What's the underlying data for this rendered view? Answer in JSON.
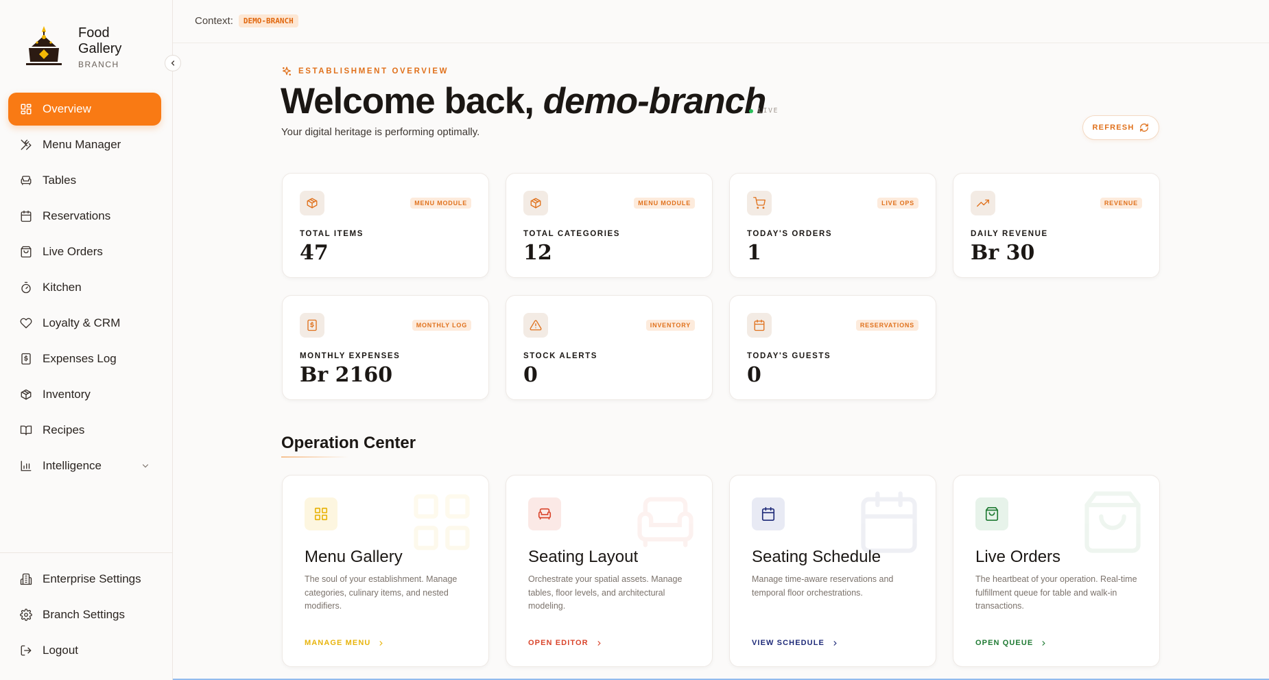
{
  "brand": {
    "name_line1": "Food",
    "name_line2": "Gallery",
    "sub": "BRANCH"
  },
  "sidebar": {
    "items": [
      {
        "label": "Overview",
        "icon": "grid-icon",
        "active": true
      },
      {
        "label": "Menu Manager",
        "icon": "utensils-icon"
      },
      {
        "label": "Tables",
        "icon": "armchair-icon"
      },
      {
        "label": "Reservations",
        "icon": "calendar-icon"
      },
      {
        "label": "Live Orders",
        "icon": "shopping-bag-icon"
      },
      {
        "label": "Kitchen",
        "icon": "timer-icon"
      },
      {
        "label": "Loyalty & CRM",
        "icon": "heart-icon"
      },
      {
        "label": "Expenses Log",
        "icon": "receipt-icon"
      },
      {
        "label": "Inventory",
        "icon": "package-icon"
      },
      {
        "label": "Recipes",
        "icon": "book-open-icon"
      },
      {
        "label": "Intelligence",
        "icon": "bar-chart-icon"
      }
    ],
    "bottom": [
      {
        "label": "Enterprise Settings",
        "icon": "building-icon"
      },
      {
        "label": "Branch Settings",
        "icon": "gear-icon"
      },
      {
        "label": "Logout",
        "icon": "logout-icon"
      }
    ]
  },
  "topbar": {
    "context_label": "Context:",
    "context_value": "DEMO-BRANCH"
  },
  "header": {
    "eyebrow": "ESTABLISHMENT OVERVIEW",
    "welcome_prefix": "Welcome back,",
    "welcome_name": "demo-branch",
    "live_label": "LIVE",
    "subtitle": "Your digital heritage is performing optimally.",
    "refresh_label": "REFRESH"
  },
  "stats": [
    {
      "label": "TOTAL ITEMS",
      "value": "47",
      "tag": "MENU MODULE",
      "icon": "package-icon"
    },
    {
      "label": "TOTAL CATEGORIES",
      "value": "12",
      "tag": "MENU MODULE",
      "icon": "package-icon"
    },
    {
      "label": "TODAY'S ORDERS",
      "value": "1",
      "tag": "LIVE OPS",
      "icon": "cart-icon"
    },
    {
      "label": "DAILY REVENUE",
      "value": "Br 30",
      "tag": "REVENUE",
      "icon": "trending-up-icon"
    },
    {
      "label": "MONTHLY EXPENSES",
      "value": "Br 2160",
      "tag": "MONTHLY LOG",
      "icon": "receipt-icon"
    },
    {
      "label": "STOCK ALERTS",
      "value": "0",
      "tag": "INVENTORY",
      "icon": "alert-triangle-icon"
    },
    {
      "label": "TODAY'S GUESTS",
      "value": "0",
      "tag": "RESERVATIONS",
      "icon": "calendar-icon"
    }
  ],
  "operation": {
    "title": "Operation Center",
    "cards": [
      {
        "title": "Menu Gallery",
        "desc": "The soul of your establishment. Manage categories, culinary items, and nested modifiers.",
        "link": "MANAGE MENU",
        "accent": "#e8b40c",
        "bg": "#fdf6e0",
        "icon": "grid-icon"
      },
      {
        "title": "Seating Layout",
        "desc": "Orchestrate your spatial assets. Manage tables, floor levels, and architectural modeling.",
        "link": "OPEN EDITOR",
        "accent": "#d9442b",
        "bg": "#fbe9e6",
        "icon": "armchair-icon"
      },
      {
        "title": "Seating Schedule",
        "desc": "Manage time-aware reservations and temporal floor orchestrations.",
        "link": "VIEW SCHEDULE",
        "accent": "#1e2a78",
        "bg": "#e8eaf4",
        "icon": "calendar-icon"
      },
      {
        "title": "Live Orders",
        "desc": "The heartbeat of your operation. Real-time fulfillment queue for table and walk-in transactions.",
        "link": "OPEN QUEUE",
        "accent": "#1f7a33",
        "bg": "#e7f3ea",
        "icon": "shopping-bag-icon"
      }
    ]
  },
  "colors": {
    "accent": "#f97a14",
    "accent_text": "#e0711c",
    "live": "#2bbf5b"
  }
}
